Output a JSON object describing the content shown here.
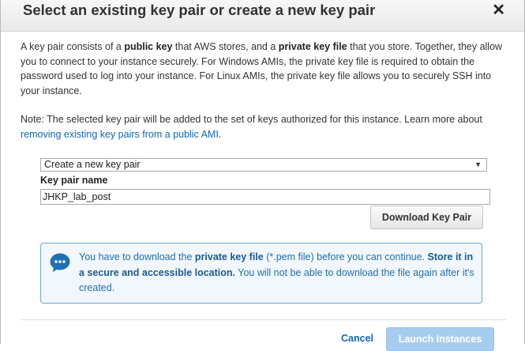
{
  "dialog": {
    "title": "Select an existing key pair or create a new key pair",
    "close_glyph": "✕"
  },
  "intro": {
    "t1": "A key pair consists of a ",
    "b1": "public key",
    "t2": " that AWS stores, and a ",
    "b2": "private key file",
    "t3": " that you store. Together, they allow you to connect to your instance securely. For Windows AMIs, the private key file is required to obtain the password used to log into your instance. For Linux AMIs, the private key file allows you to securely SSH into your instance."
  },
  "note": {
    "text": "Note: The selected key pair will be added to the set of keys authorized for this instance. Learn more about ",
    "link": "removing existing key pairs from a public AMI",
    "end": "."
  },
  "key_select": {
    "selected": "Create a new key pair",
    "arrow": "▼"
  },
  "key_name": {
    "label": "Key pair name",
    "value": "JHKP_lab_post"
  },
  "download_button": "Download Key Pair",
  "info": {
    "icon": "speech-bubble-icon",
    "t1": "You have to download the ",
    "b1": "private key file",
    "t2": " (*.pem file) before you can continue. ",
    "b2": "Store it in a secure and accessible location.",
    "t3": " You will not be able to download the file again after it's created."
  },
  "footer": {
    "cancel": "Cancel",
    "launch": "Launch Instances"
  },
  "colors": {
    "link": "#1166bb",
    "info_border": "#6aa7d9",
    "info_bg": "#f1f7fc",
    "launch_disabled": "#a7cdee"
  }
}
